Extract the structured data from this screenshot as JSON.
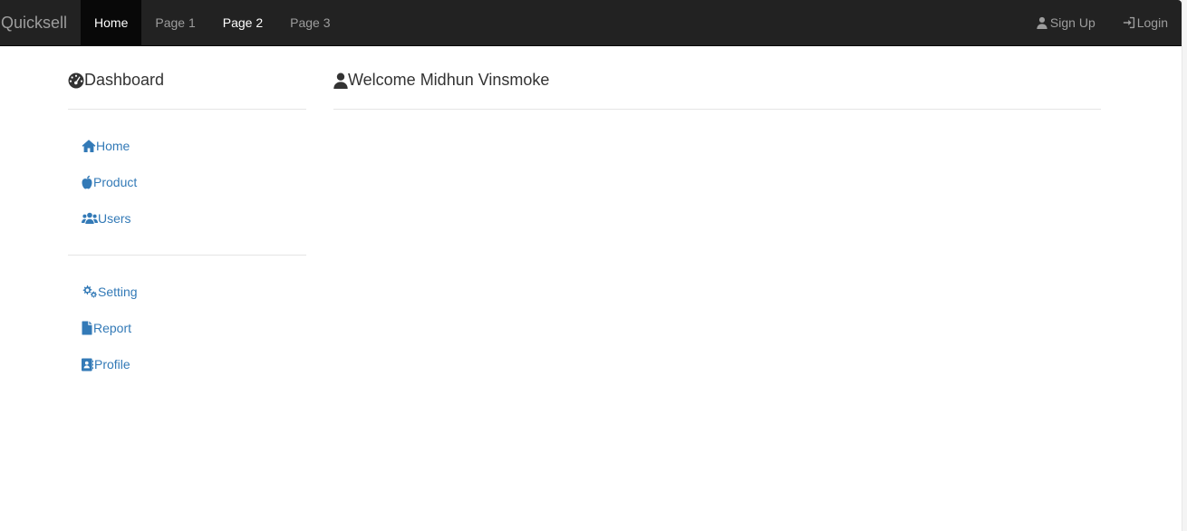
{
  "navbar": {
    "brand": "Quicksell",
    "links": [
      {
        "label": "Home"
      },
      {
        "label": "Page 1"
      },
      {
        "label": "Page 2"
      },
      {
        "label": "Page 3"
      }
    ],
    "right": {
      "signup_label": "Sign Up",
      "signup_icon": "user-icon",
      "login_label": "Login",
      "login_icon": "sign-in-icon"
    },
    "colors": {
      "background": "#222222",
      "active_bg": "#080808",
      "text": "#9d9d9d",
      "active_text": "#ffffff"
    }
  },
  "sidebar": {
    "title": "Dashboard",
    "title_icon": "tachometer-icon",
    "groups": [
      {
        "items": [
          {
            "label": "Home",
            "icon": "home-icon"
          },
          {
            "label": "Product",
            "icon": "apple-icon"
          },
          {
            "label": "Users",
            "icon": "users-icon"
          }
        ]
      },
      {
        "items": [
          {
            "label": "Setting",
            "icon": "cogs-icon"
          },
          {
            "label": "Report",
            "icon": "file-icon"
          },
          {
            "label": "Profile",
            "icon": "address-card-icon"
          }
        ]
      }
    ],
    "link_color": "#337ab7"
  },
  "main": {
    "title": "Welcome Midhun Vinsmoke",
    "title_icon": "user-icon"
  }
}
